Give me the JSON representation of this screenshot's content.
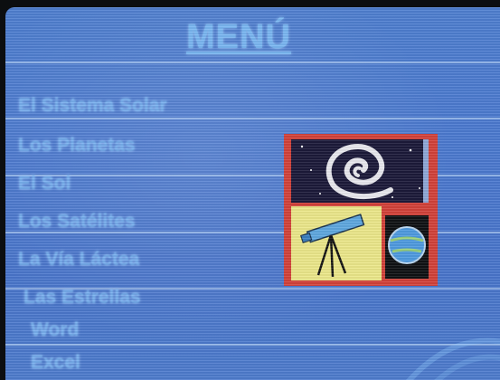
{
  "window": {
    "title": "MENÚ"
  },
  "menu": {
    "items": [
      {
        "label": "El Sistema Solar"
      },
      {
        "label": "Los Planetas"
      },
      {
        "label": "El Sol"
      },
      {
        "label": "Los Satélites"
      },
      {
        "label": "La Vía Láctea"
      },
      {
        "label": "Las Estrellas"
      },
      {
        "label": "Word"
      },
      {
        "label": "Excel"
      }
    ]
  },
  "illustration": {
    "icons": [
      "spiral-galaxy-icon",
      "telescope-icon",
      "planet-icon"
    ]
  },
  "colors": {
    "background": "#4c7ad0",
    "text": "#78b0ee",
    "illustration_frame": "#d3423a",
    "telescope_panel": "#ece88a",
    "galaxy_bg": "#1c1a3a"
  }
}
